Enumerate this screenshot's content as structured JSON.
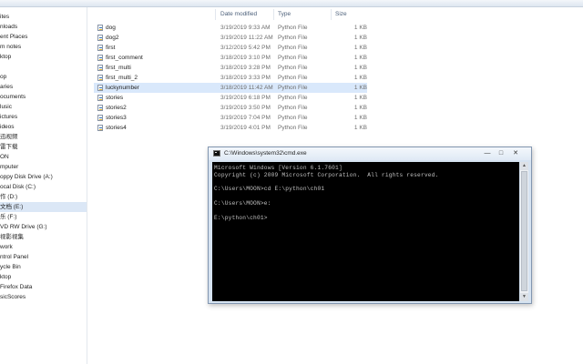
{
  "explorer": {
    "nav_items": [
      {
        "label": "ites"
      },
      {
        "label": "nloads"
      },
      {
        "label": "ent Places"
      },
      {
        "label": "m notes"
      },
      {
        "label": "ktop"
      },
      {
        "label": ""
      },
      {
        "label": "op"
      },
      {
        "label": "aries"
      },
      {
        "label": "ocuments"
      },
      {
        "label": "lusic"
      },
      {
        "label": "ictures"
      },
      {
        "label": "ideos"
      },
      {
        "label": "迅视频"
      },
      {
        "label": "雷下载"
      },
      {
        "label": "ON"
      },
      {
        "label": "mputer"
      },
      {
        "label": "oppy Disk Drive (A:)"
      },
      {
        "label": "ocal Disk (C:)"
      },
      {
        "label": "作 (D:)"
      },
      {
        "label": "文档 (E:)"
      },
      {
        "label": "乐 (F:)"
      },
      {
        "label": "VD RW Drive (G:)"
      },
      {
        "label": "视影视集"
      },
      {
        "label": "work"
      },
      {
        "label": "ntrol Panel"
      },
      {
        "label": "ycle Bin"
      },
      {
        "label": "ktop"
      },
      {
        "label": "Firefox Data"
      },
      {
        "label": "sicScores"
      }
    ],
    "columns": {
      "name": "",
      "date": "Date modified",
      "type": "Type",
      "size": "Size"
    },
    "files": [
      {
        "name": "dog",
        "date": "3/19/2019 9:33 AM",
        "type": "Python File",
        "size": "1 KB"
      },
      {
        "name": "dog2",
        "date": "3/19/2019 11:22 AM",
        "type": "Python File",
        "size": "1 KB"
      },
      {
        "name": "first",
        "date": "3/12/2019 5:42 PM",
        "type": "Python File",
        "size": "1 KB"
      },
      {
        "name": "first_comment",
        "date": "3/18/2019 3:10 PM",
        "type": "Python File",
        "size": "1 KB"
      },
      {
        "name": "first_multi",
        "date": "3/18/2019 3:28 PM",
        "type": "Python File",
        "size": "1 KB"
      },
      {
        "name": "first_multi_2",
        "date": "3/18/2019 3:33 PM",
        "type": "Python File",
        "size": "1 KB"
      },
      {
        "name": "luckynumber",
        "date": "3/18/2019 11:42 AM",
        "type": "Python File",
        "size": "1 KB"
      },
      {
        "name": "stories",
        "date": "3/19/2019 6:18 PM",
        "type": "Python File",
        "size": "1 KB"
      },
      {
        "name": "stories2",
        "date": "3/19/2019 3:50 PM",
        "type": "Python File",
        "size": "1 KB"
      },
      {
        "name": "stories3",
        "date": "3/19/2019 7:04 PM",
        "type": "Python File",
        "size": "1 KB"
      },
      {
        "name": "stories4",
        "date": "3/19/2019 4:01 PM",
        "type": "Python File",
        "size": "1 KB"
      }
    ]
  },
  "cmd": {
    "title": "C:\\Windows\\system32\\cmd.exe",
    "minimize_glyph": "—",
    "maximize_glyph": "□",
    "close_glyph": "✕",
    "lines": [
      "Microsoft Windows [Version 6.1.7601]",
      "Copyright (c) 2009 Microsoft Corporation.  All rights reserved.",
      "",
      "C:\\Users\\MOON>cd E:\\python\\ch01",
      "",
      "C:\\Users\\MOON>e:",
      "",
      "E:\\python\\ch01>"
    ]
  },
  "colors": {
    "selection": "#d9e8fb",
    "console_bg": "#000000",
    "console_text": "#c0c0c0"
  }
}
